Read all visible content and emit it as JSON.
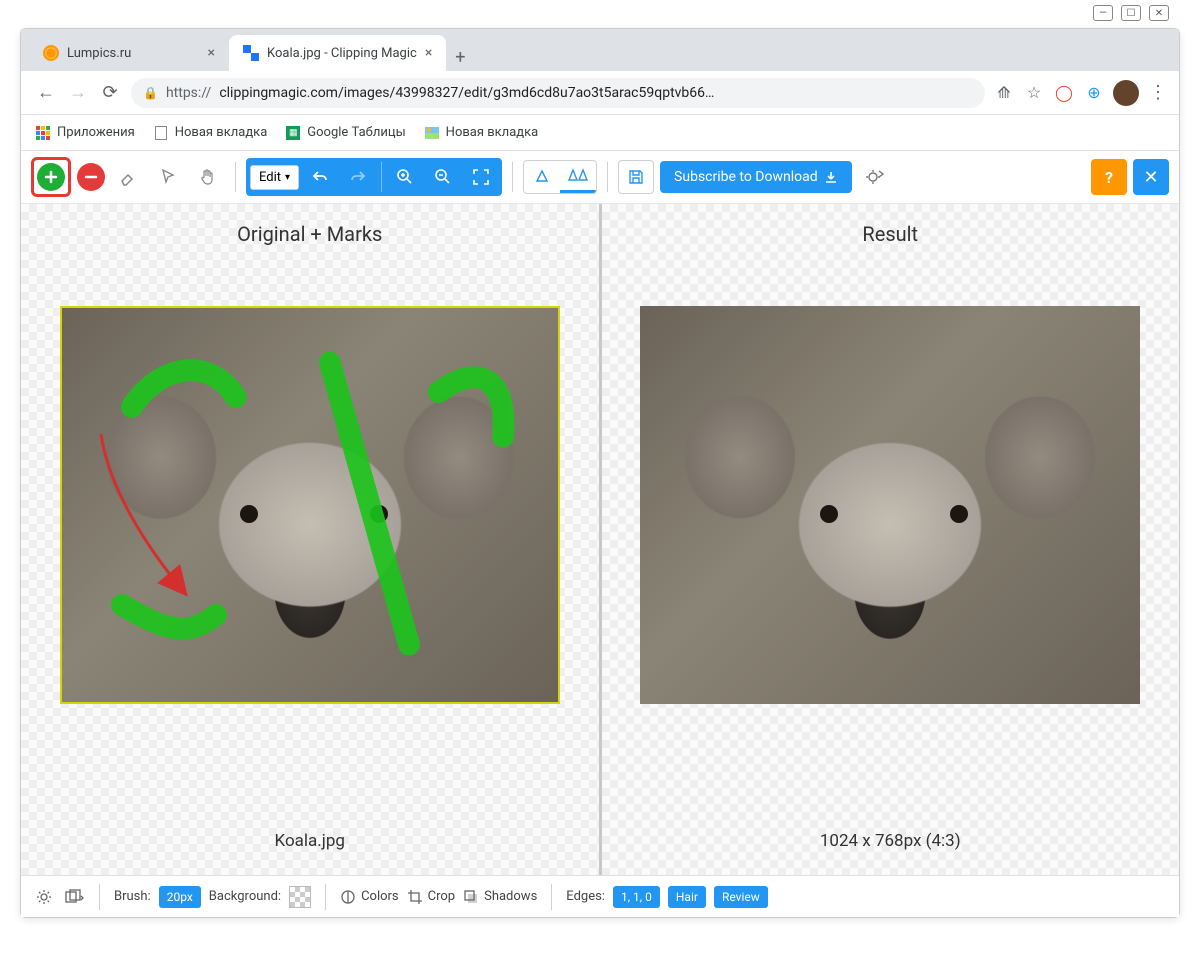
{
  "browser": {
    "tabs": [
      {
        "title": "Lumpics.ru",
        "active": false
      },
      {
        "title": "Koala.jpg - Clipping Magic",
        "active": true
      }
    ],
    "url_protocol": "https://",
    "url_rest": "clippingmagic.com/images/43998327/edit/g3md6cd8u7ao3t5arac59qptvb66…",
    "bookmarks": [
      {
        "label": "Приложения",
        "icon": "apps"
      },
      {
        "label": "Новая вкладка",
        "icon": "doc"
      },
      {
        "label": "Google Таблицы",
        "icon": "sheets"
      },
      {
        "label": "Новая вкладка",
        "icon": "img"
      }
    ]
  },
  "toolbar": {
    "edit_label": "Edit",
    "subscribe_label": "Subscribe to Download",
    "help_label": "?",
    "close_label": "✕"
  },
  "panels": {
    "left_title": "Original + Marks",
    "right_title": "Result",
    "left_footer": "Koala.jpg",
    "right_footer": "1024 x 768px (4:3)"
  },
  "bottombar": {
    "brush_label": "Brush:",
    "brush_value": "20px",
    "background_label": "Background:",
    "colors_label": "Colors",
    "crop_label": "Crop",
    "shadows_label": "Shadows",
    "edges_label": "Edges:",
    "edges_value": "1, 1, 0",
    "hair_label": "Hair",
    "review_label": "Review"
  }
}
